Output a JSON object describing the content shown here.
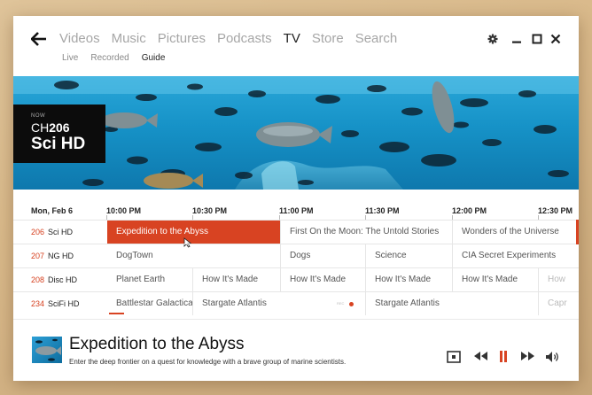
{
  "nav": {
    "back_icon": "back-arrow-icon",
    "items": [
      {
        "label": "Videos"
      },
      {
        "label": "Music"
      },
      {
        "label": "Pictures"
      },
      {
        "label": "Podcasts"
      },
      {
        "label": "TV"
      },
      {
        "label": "Store"
      },
      {
        "label": "Search"
      }
    ],
    "active": "TV"
  },
  "subnav": {
    "items": [
      {
        "label": "Live"
      },
      {
        "label": "Recorded"
      },
      {
        "label": "Guide"
      }
    ],
    "active": "Guide"
  },
  "window_controls": {
    "settings_icon": "gear-icon",
    "minimize_icon": "minimize-icon",
    "maximize_icon": "maximize-icon",
    "close_icon": "close-icon"
  },
  "now_channel": {
    "now_label": "NOW",
    "ch_prefix": "CH",
    "ch_number": "206",
    "name": "Sci HD"
  },
  "guide": {
    "date": "Mon, Feb 6",
    "times": [
      "10:00 PM",
      "10:30 PM",
      "11:00 PM",
      "11:30 PM",
      "12:00 PM",
      "12:30 PM"
    ],
    "rows": [
      {
        "num": "206",
        "name": "Sci HD",
        "programs": [
          {
            "title": "Expedition to the Abyss",
            "selected": true
          },
          {
            "title": "First On the Moon: The Untold Stories"
          },
          {
            "title": "Wonders of the Universe"
          }
        ]
      },
      {
        "num": "207",
        "name": "NG HD",
        "programs": [
          {
            "title": "DogTown"
          },
          {
            "title": "Dogs"
          },
          {
            "title": "Science"
          },
          {
            "title": "CIA Secret Experiments"
          }
        ]
      },
      {
        "num": "208",
        "name": "Disc HD",
        "programs": [
          {
            "title": "Planet Earth"
          },
          {
            "title": "How It's Made"
          },
          {
            "title": "How It's Made"
          },
          {
            "title": "How It's Made"
          },
          {
            "title": "How It's Made"
          },
          {
            "title": "How"
          }
        ]
      },
      {
        "num": "234",
        "name": "SciFi HD",
        "programs": [
          {
            "title": "Battlestar Galactica"
          },
          {
            "title": "Stargate Atlantis"
          },
          {
            "title": "Stargate Atlantis"
          },
          {
            "title": "Capr"
          }
        ]
      }
    ],
    "rec_label": "REC",
    "accent": "#d84322"
  },
  "now_playing": {
    "title": "Expedition to the Abyss",
    "description": "Enter the deep frontier on a quest for knowledge with a brave group of marine scientists.",
    "controls": [
      "screen-icon",
      "rewind-icon",
      "pause-icon",
      "fast-forward-icon",
      "volume-icon"
    ]
  }
}
